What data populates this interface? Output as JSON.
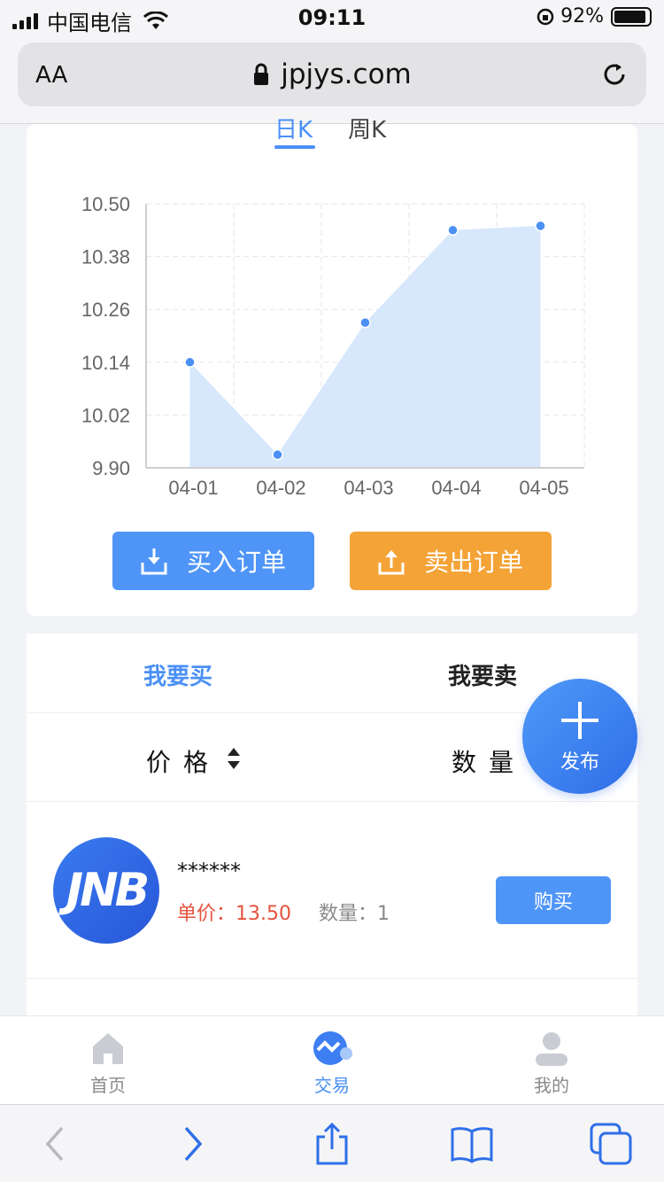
{
  "status": {
    "carrier": "中国电信",
    "time": "09:11",
    "battery": "92%",
    "battery_level": 0.92
  },
  "browser": {
    "aa": "AA",
    "url": "jpjys.com"
  },
  "kline_tabs": [
    "日K",
    "周K"
  ],
  "chart_data": {
    "type": "area",
    "categories": [
      "04-01",
      "04-02",
      "04-03",
      "04-04",
      "04-05"
    ],
    "values": [
      10.14,
      9.93,
      10.23,
      10.44,
      10.45
    ],
    "ylim": [
      9.9,
      10.5
    ],
    "yticks": [
      "10.50",
      "10.38",
      "10.26",
      "10.14",
      "10.02",
      "9.90"
    ],
    "grid": true,
    "colors": {
      "fill": "#d7e7fc",
      "point": "#4a90f5"
    }
  },
  "actions": {
    "buy_order": "买入订单",
    "sell_order": "卖出订单"
  },
  "trade": {
    "tab_buy": "我要买",
    "tab_sell": "我要卖",
    "col_price": "价格",
    "col_qty": "数量"
  },
  "fab": {
    "label": "发布"
  },
  "listing": {
    "avatar_text": "JNB",
    "user": "******",
    "price": "单价：13.50",
    "qty": "数量：1",
    "buy_label": "购买"
  },
  "tabbar": {
    "home": "首页",
    "trade": "交易",
    "mine": "我的"
  },
  "colors": {
    "accent": "#4a90f5",
    "orange": "#f4a336",
    "price_red": "#e5533d"
  }
}
